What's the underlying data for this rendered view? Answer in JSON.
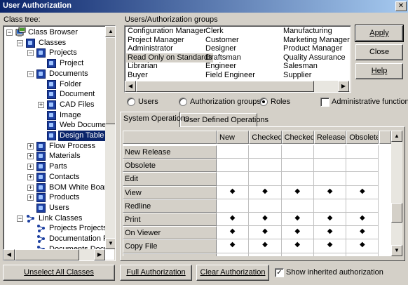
{
  "window": {
    "title": "User Authorization",
    "close_glyph": "✕"
  },
  "class_tree": {
    "label": "Class tree:",
    "items": [
      {
        "label": "Class Browser",
        "depth": 0,
        "expander": "−",
        "icon": "root-icon"
      },
      {
        "label": "Classes",
        "depth": 1,
        "expander": "−",
        "icon": "class-icon"
      },
      {
        "label": "Projects",
        "depth": 2,
        "expander": "−",
        "icon": "class-icon"
      },
      {
        "label": "Project",
        "depth": 3,
        "expander": "",
        "icon": "class-icon"
      },
      {
        "label": "Documents",
        "depth": 2,
        "expander": "−",
        "icon": "class-icon"
      },
      {
        "label": "Folder",
        "depth": 3,
        "expander": "",
        "icon": "class-icon"
      },
      {
        "label": "Document",
        "depth": 3,
        "expander": "",
        "icon": "class-icon"
      },
      {
        "label": "CAD Files",
        "depth": 3,
        "expander": "+",
        "icon": "class-icon"
      },
      {
        "label": "Image",
        "depth": 3,
        "expander": "",
        "icon": "class-icon"
      },
      {
        "label": "Web Document",
        "depth": 3,
        "expander": "",
        "icon": "class-icon"
      },
      {
        "label": "Design Table",
        "depth": 3,
        "expander": "",
        "icon": "class-icon",
        "selected": true
      },
      {
        "label": "Flow Process",
        "depth": 2,
        "expander": "+",
        "icon": "class-icon"
      },
      {
        "label": "Materials",
        "depth": 2,
        "expander": "+",
        "icon": "class-icon"
      },
      {
        "label": "Parts",
        "depth": 2,
        "expander": "+",
        "icon": "class-icon"
      },
      {
        "label": "Contacts",
        "depth": 2,
        "expander": "+",
        "icon": "class-icon"
      },
      {
        "label": "BOM White Board",
        "depth": 2,
        "expander": "+",
        "icon": "class-icon"
      },
      {
        "label": "Products",
        "depth": 2,
        "expander": "+",
        "icon": "class-icon"
      },
      {
        "label": "Users",
        "depth": 2,
        "expander": "",
        "icon": "class-icon"
      },
      {
        "label": "Link Classes",
        "depth": 1,
        "expander": "−",
        "icon": "link-icon"
      },
      {
        "label": "Projects Projects Re",
        "depth": 2,
        "expander": "",
        "icon": "link-icon"
      },
      {
        "label": "Documentation Proj",
        "depth": 2,
        "expander": "",
        "icon": "link-icon"
      },
      {
        "label": "Documents Docum",
        "depth": 2,
        "expander": "",
        "icon": "link-icon"
      }
    ]
  },
  "users_groups": {
    "label": "Users/Authorization groups",
    "columns": [
      [
        "Configuration Manager",
        "Project Manager",
        "Administrator",
        "Read Only on Standards",
        "Librarian",
        "Buyer"
      ],
      [
        "Clerk",
        "Customer",
        "Designer",
        "Draftsman",
        "Engineer",
        "Field Engineer"
      ],
      [
        "Manufacturing",
        "Marketing Manager",
        "Product Manager",
        "Quality Assurance",
        "Salesman",
        "Supplier"
      ]
    ],
    "highlighted": "Read Only on Standards"
  },
  "buttons": {
    "apply": "Apply",
    "close": "Close",
    "help": "Help",
    "unselect_all": "Unselect All Classes",
    "full_auth": "Full Authorization",
    "clear_auth": "Clear Authorization"
  },
  "filter": {
    "users": "Users",
    "groups": "Authorization groups",
    "roles": "Roles",
    "selected": "Roles",
    "admin_functions": "Administrative functions",
    "admin_checked": false
  },
  "tabs": [
    {
      "label": "System Operations",
      "active": true
    },
    {
      "label": "User Defined Operations",
      "active": false
    }
  ],
  "operations_grid": {
    "columns": [
      "New",
      "Checked I",
      "Checked (",
      "Released",
      "Obsolete"
    ],
    "rows": [
      {
        "label": "New Release",
        "marks": [
          false,
          false,
          false,
          false,
          false
        ]
      },
      {
        "label": "Obsolete",
        "marks": [
          false,
          false,
          false,
          false,
          false
        ]
      },
      {
        "label": "Edit",
        "marks": [
          false,
          false,
          false,
          false,
          false
        ]
      },
      {
        "label": "View",
        "marks": [
          true,
          true,
          true,
          true,
          true
        ]
      },
      {
        "label": "Redline",
        "marks": [
          false,
          false,
          false,
          false,
          false
        ]
      },
      {
        "label": "Print",
        "marks": [
          true,
          true,
          true,
          true,
          true
        ]
      },
      {
        "label": "On Viewer",
        "marks": [
          true,
          true,
          true,
          true,
          true
        ]
      },
      {
        "label": "Copy File",
        "marks": [
          true,
          true,
          true,
          true,
          true
        ]
      },
      {
        "label": "On Drop Files",
        "marks": [
          false,
          false,
          false,
          false,
          false
        ]
      }
    ],
    "mark_glyph": "◆"
  },
  "show_inherited": {
    "label": "Show inherited authorization",
    "checked": true
  }
}
